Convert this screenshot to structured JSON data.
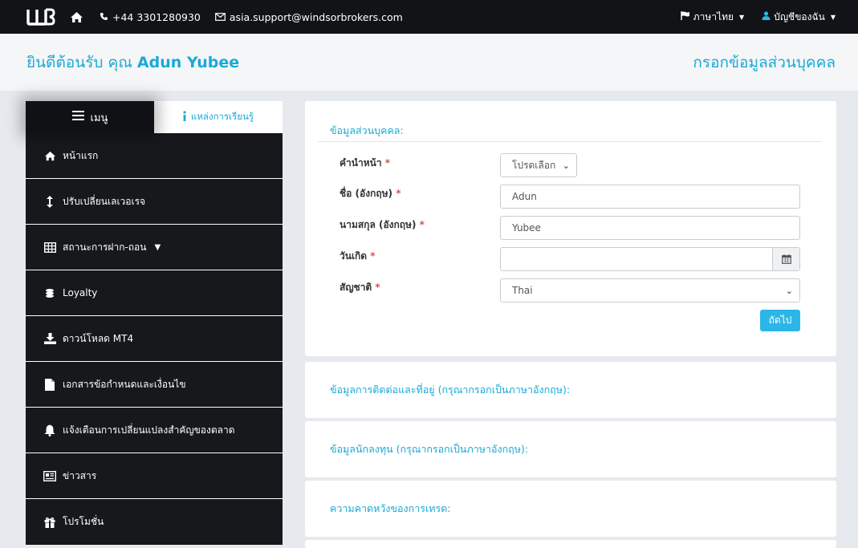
{
  "topbar": {
    "phone": "+44 3301280930",
    "email": "asia.support@windsorbrokers.com",
    "language": "ภาษาไทย",
    "account": "บัญชีของฉัน"
  },
  "header": {
    "welcome_prefix": "ยินดีต้อนรับ คุณ",
    "user_name": "Adun Yubee",
    "page_title": "กรอกข้อมูลส่วนบุคคล"
  },
  "sidebar": {
    "tab_menu": "เมนู",
    "tab_learning": "แหล่งการเรียนรู้",
    "items": [
      {
        "label": "หน้าแรก",
        "icon": "home-icon"
      },
      {
        "label": "ปรับเปลี่ยนเลเวอเรจ",
        "icon": "vertical-arrows-icon"
      },
      {
        "label": "สถานะการฝาก-ถอน",
        "icon": "table-icon"
      },
      {
        "label": "Loyalty",
        "icon": "coins-icon"
      },
      {
        "label": "ดาวน์โหลด MT4",
        "icon": "download-icon"
      },
      {
        "label": "เอกสารข้อกำหนดและเงื่อนไข",
        "icon": "file-icon"
      },
      {
        "label": "แจ้งเตือนการเปลี่ยนแปลงสำคัญของตลาด",
        "icon": "bell-icon"
      },
      {
        "label": "ข่าวสาร",
        "icon": "newspaper-icon"
      },
      {
        "label": "โปรโมชั่น",
        "icon": "gift-icon"
      }
    ]
  },
  "form": {
    "section_title": "ข้อมูลส่วนบุคคล:",
    "title_label": "คำนำหน้า",
    "title_value": "โปรดเลือก",
    "first_name_label": "ชื่อ (อังกฤษ)",
    "first_name_value": "Adun",
    "last_name_label": "นามสกุล (อังกฤษ)",
    "last_name_value": "Yubee",
    "dob_label": "วันเกิด",
    "dob_value": "",
    "nationality_label": "สัญชาติ",
    "nationality_value": "Thai",
    "required_mark": "*",
    "next_button": "ถัดไป"
  },
  "sections": [
    "ข้อมูลการติดต่อและที่อยู่ (กรุณากรอกเป็นภาษาอังกฤษ):",
    "ข้อมูลนักลงทุน (กรุณากรอกเป็นภาษาอังกฤษ):",
    "ความคาดหวังของการเทรด:"
  ],
  "colors": {
    "accent": "#1aa9d8",
    "button": "#2bb6e8",
    "topbar": "#111317",
    "sidebar": "#16181c"
  }
}
